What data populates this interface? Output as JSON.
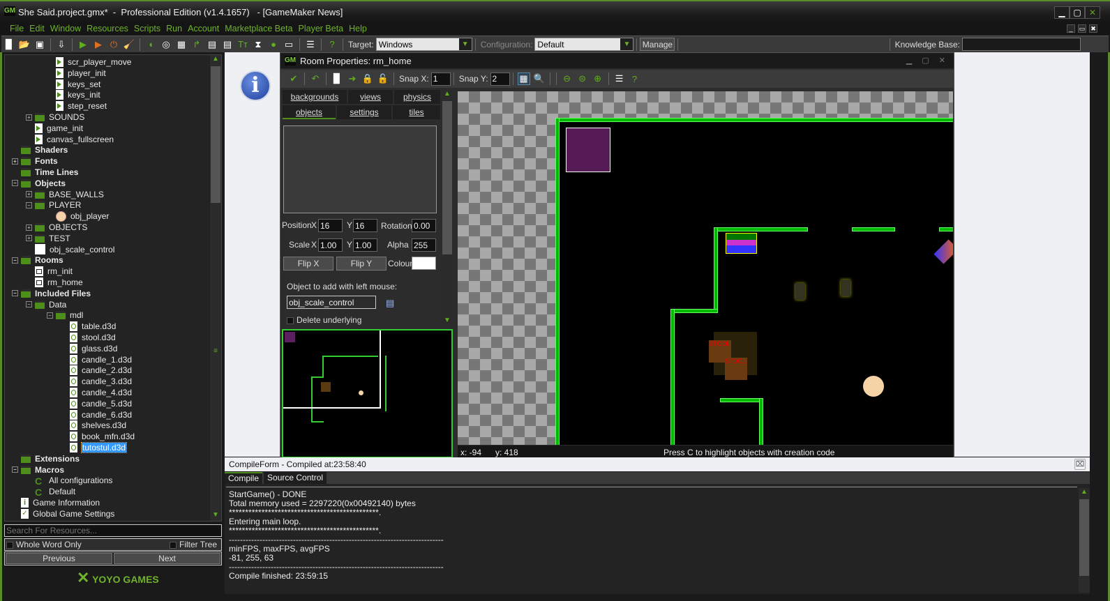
{
  "window": {
    "title": "She Said.project.gmx*  -  Professional Edition (v1.4.1657)   - [GameMaker News]",
    "logo": "GM",
    "controls": [
      "minimize",
      "maximize",
      "close"
    ]
  },
  "menu": [
    "File",
    "Edit",
    "Window",
    "Resources",
    "Scripts",
    "Run",
    "Account",
    "Marketplace Beta",
    "Player Beta",
    "Help"
  ],
  "toolbar": {
    "icons": [
      "new-project-icon",
      "open-project-icon",
      "save-icon",
      "export-icon",
      "run-icon",
      "debug-icon",
      "stop-icon",
      "clean-icon",
      "sprite-icon",
      "sound-icon",
      "background-icon",
      "path-icon",
      "script-icon",
      "shader-icon",
      "font-icon",
      "timeline-icon",
      "object-icon",
      "room-icon",
      "settings-icon",
      "help-icon"
    ],
    "target_label": "Target:",
    "target_value": "Windows",
    "config_label": "Configuration:",
    "config_value": "Default",
    "manage_label": "Manage",
    "knowledge_label": "Knowledge Base:",
    "knowledge_value": ""
  },
  "tree": [
    {
      "label": "scr_player_move",
      "icon": "script",
      "level": 3
    },
    {
      "label": "player_init",
      "icon": "script",
      "level": 3
    },
    {
      "label": "keys_set",
      "icon": "script",
      "level": 3
    },
    {
      "label": "keys_init",
      "icon": "script",
      "level": 3
    },
    {
      "label": "step_reset",
      "icon": "script",
      "level": 3
    },
    {
      "label": "SOUNDS",
      "icon": "folder",
      "level": 2,
      "exp": "+"
    },
    {
      "label": "game_init",
      "icon": "script",
      "level": 2
    },
    {
      "label": "canvas_fullscreen",
      "icon": "script",
      "level": 2
    },
    {
      "label": "Shaders",
      "icon": "folder",
      "level": 1,
      "bold": true
    },
    {
      "label": "Fonts",
      "icon": "folder",
      "level": 1,
      "bold": true,
      "exp": "+"
    },
    {
      "label": "Time Lines",
      "icon": "folder",
      "level": 1,
      "bold": true
    },
    {
      "label": "Objects",
      "icon": "folder",
      "level": 1,
      "bold": true,
      "exp": "-"
    },
    {
      "label": "BASE_WALLS",
      "icon": "folder",
      "level": 2,
      "exp": "+"
    },
    {
      "label": "PLAYER",
      "icon": "folder",
      "level": 2,
      "exp": "-"
    },
    {
      "label": "obj_player",
      "icon": "face",
      "level": 3
    },
    {
      "label": "OBJECTS",
      "icon": "folder",
      "level": 2,
      "exp": "+"
    },
    {
      "label": "TEST",
      "icon": "folder",
      "level": 2,
      "exp": "+"
    },
    {
      "label": "obj_scale_control",
      "icon": "white",
      "level": 2
    },
    {
      "label": "Rooms",
      "icon": "folder",
      "level": 1,
      "bold": true,
      "exp": "-"
    },
    {
      "label": "rm_init",
      "icon": "room",
      "level": 2
    },
    {
      "label": "rm_home",
      "icon": "room",
      "level": 2
    },
    {
      "label": "Included Files",
      "icon": "folder",
      "level": 1,
      "bold": true,
      "exp": "-"
    },
    {
      "label": "Data",
      "icon": "folder",
      "level": 2,
      "exp": "-"
    },
    {
      "label": "mdl",
      "icon": "folder",
      "level": 3,
      "exp": "-"
    },
    {
      "label": "table.d3d",
      "icon": "file",
      "level": 4
    },
    {
      "label": "stool.d3d",
      "icon": "file",
      "level": 4
    },
    {
      "label": "glass.d3d",
      "icon": "file",
      "level": 4
    },
    {
      "label": "candle_1.d3d",
      "icon": "file",
      "level": 4
    },
    {
      "label": "candle_2.d3d",
      "icon": "file",
      "level": 4
    },
    {
      "label": "candle_3.d3d",
      "icon": "file",
      "level": 4
    },
    {
      "label": "candle_4.d3d",
      "icon": "file",
      "level": 4
    },
    {
      "label": "candle_5.d3d",
      "icon": "file",
      "level": 4
    },
    {
      "label": "candle_6.d3d",
      "icon": "file",
      "level": 4
    },
    {
      "label": "shelves.d3d",
      "icon": "file",
      "level": 4
    },
    {
      "label": "book_mfn.d3d",
      "icon": "file",
      "level": 4
    },
    {
      "label": "tutostul.d3d",
      "icon": "file",
      "level": 4,
      "selected": true
    },
    {
      "label": "Extensions",
      "icon": "folder",
      "level": 1,
      "bold": true
    },
    {
      "label": "Macros",
      "icon": "folder",
      "level": 1,
      "bold": true,
      "exp": "-"
    },
    {
      "label": "All configurations",
      "icon": "macro",
      "level": 2
    },
    {
      "label": "Default",
      "icon": "macro",
      "level": 2
    },
    {
      "label": "Game Information",
      "icon": "info",
      "level": 1
    },
    {
      "label": "Global Game Settings",
      "icon": "check",
      "level": 1
    }
  ],
  "search": {
    "placeholder": "Search For Resources...",
    "whole_word_label": "Whole Word Only",
    "filter_tree_label": "Filter Tree",
    "previous_label": "Previous",
    "next_label": "Next"
  },
  "brand": {
    "name": "YOYO GAMES"
  },
  "room": {
    "title": "Room Properties: rm_home",
    "snap_x_label": "Snap X:",
    "snap_x": "1",
    "snap_y_label": "Snap Y:",
    "snap_y": "2",
    "tabs_row1": [
      "backgrounds",
      "views",
      "physics"
    ],
    "tabs_row2": [
      "objects",
      "settings",
      "tiles"
    ],
    "active_tab": "objects",
    "position_label": "Position",
    "x_label": "X",
    "y_label": "Y",
    "pos_x": "16",
    "pos_y": "16",
    "rotation_label": "Rotation",
    "rotation": "0.00",
    "scale_label": "Scale",
    "scale_x": "1.00",
    "scale_y": "1.00",
    "alpha_label": "Alpha",
    "alpha": "255",
    "flip_x_label": "Flip X",
    "flip_y_label": "Flip Y",
    "colour_label": "Colour",
    "colour": "#ffffff",
    "object_add_label": "Object to add with left mouse:",
    "object_add_value": "obj_scale_control",
    "delete_underlying_label": "Delete underlying",
    "status_x": "x: -94",
    "status_y": "y: 418",
    "status_hint": "Press C to highlight objects with creation code"
  },
  "compile": {
    "header": "CompileForm - Compiled at:23:58:40",
    "tabs": [
      "Compile",
      "Source Control"
    ],
    "output": [
      "StartGame() - DONE",
      "Total memory used = 2297220(0x00492140) bytes",
      "**********************************************.",
      "Entering main loop.",
      "**********************************************.",
      "-----------------------------------------------------------------------------",
      "minFPS, maxFPS, avgFPS",
      "-81, 255, 63",
      "-----------------------------------------------------------------------------",
      "Compile finished: 23:59:15"
    ]
  },
  "colors": {
    "accent": "#6fb22b",
    "wall": "#00bb00",
    "selection": "#3399ff"
  }
}
